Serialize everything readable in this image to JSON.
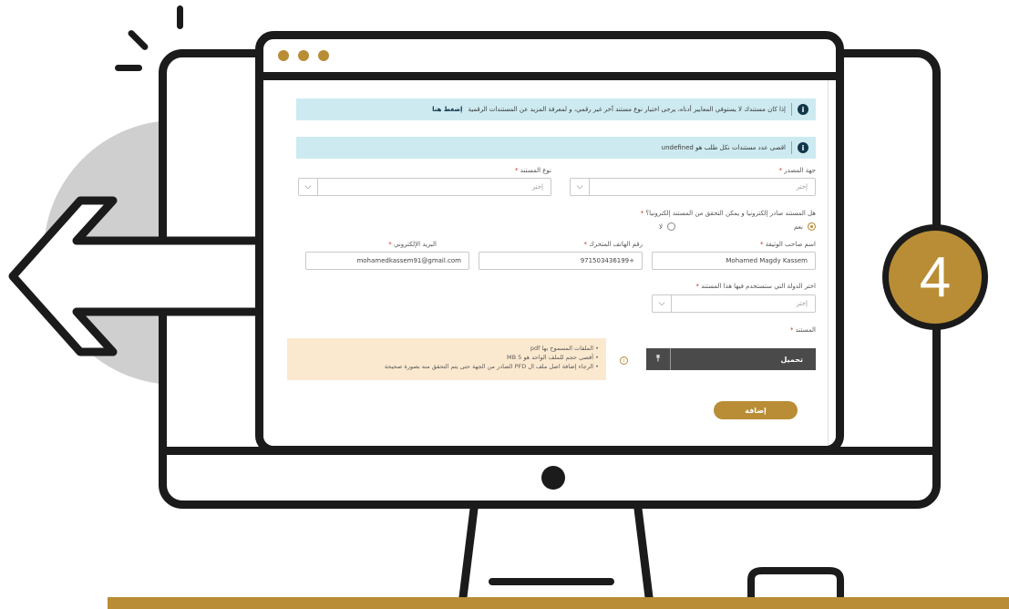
{
  "step": {
    "number": "4"
  },
  "colors": {
    "accent": "#b98d35",
    "info": "#10364a",
    "alert_bg": "#cdeaf1",
    "notice_bg": "#fbe9cf"
  },
  "icons": [
    "back-arrow-icon",
    "info-icon",
    "chevron-down-icon",
    "upload-icon",
    "hint-icon"
  ],
  "form": {
    "alert_quality": {
      "text": "إذا كان مستندك لا يستوفي المعايير أدناه، يرجى اختيار نوع مستند آخر غير رقمي، و لمعرفة المزيد عن المستندات الرقمية",
      "link": "إضغط هنا"
    },
    "alert_limit": {
      "text": "اقصى عدد مستندات نكل طلب هو undefined"
    },
    "issuer": {
      "label": "جهة المصدر",
      "placeholder": "إختر"
    },
    "doc_type": {
      "label": "نوع المستند",
      "placeholder": "إختر"
    },
    "electronic_question": {
      "label": "هل المستند صادر إلكترونيا و يمكن التحقق من المستند إلكترونيا؟",
      "yes": "نعم",
      "no": "لا"
    },
    "owner_name": {
      "label": "اسم صاحب الوثيقة",
      "value": "Mohamed Magdy Kassem"
    },
    "mobile": {
      "label": "رقم الهاتف المتحرك",
      "value": "971503436199+"
    },
    "email": {
      "label": "البريد الإلكتروني",
      "value": "mohamedkassem91@gmail.com"
    },
    "country": {
      "label": "اختر الدولة التي ستستخدم فيها هذا المستند",
      "placeholder": "إختر"
    },
    "document": {
      "label": "المستند"
    },
    "upload": {
      "label": "تحميل"
    },
    "notice": [
      "الملفات المسموح بها pdf",
      "أقصى حجم للملف الواحد هو 5 MB",
      "الرجاء إضافة اصل ملف ال PFD الصادر من الجهة حتى يتم التحقق منه بصورة صحيحة"
    ],
    "submit": {
      "label": "إضافة"
    }
  }
}
